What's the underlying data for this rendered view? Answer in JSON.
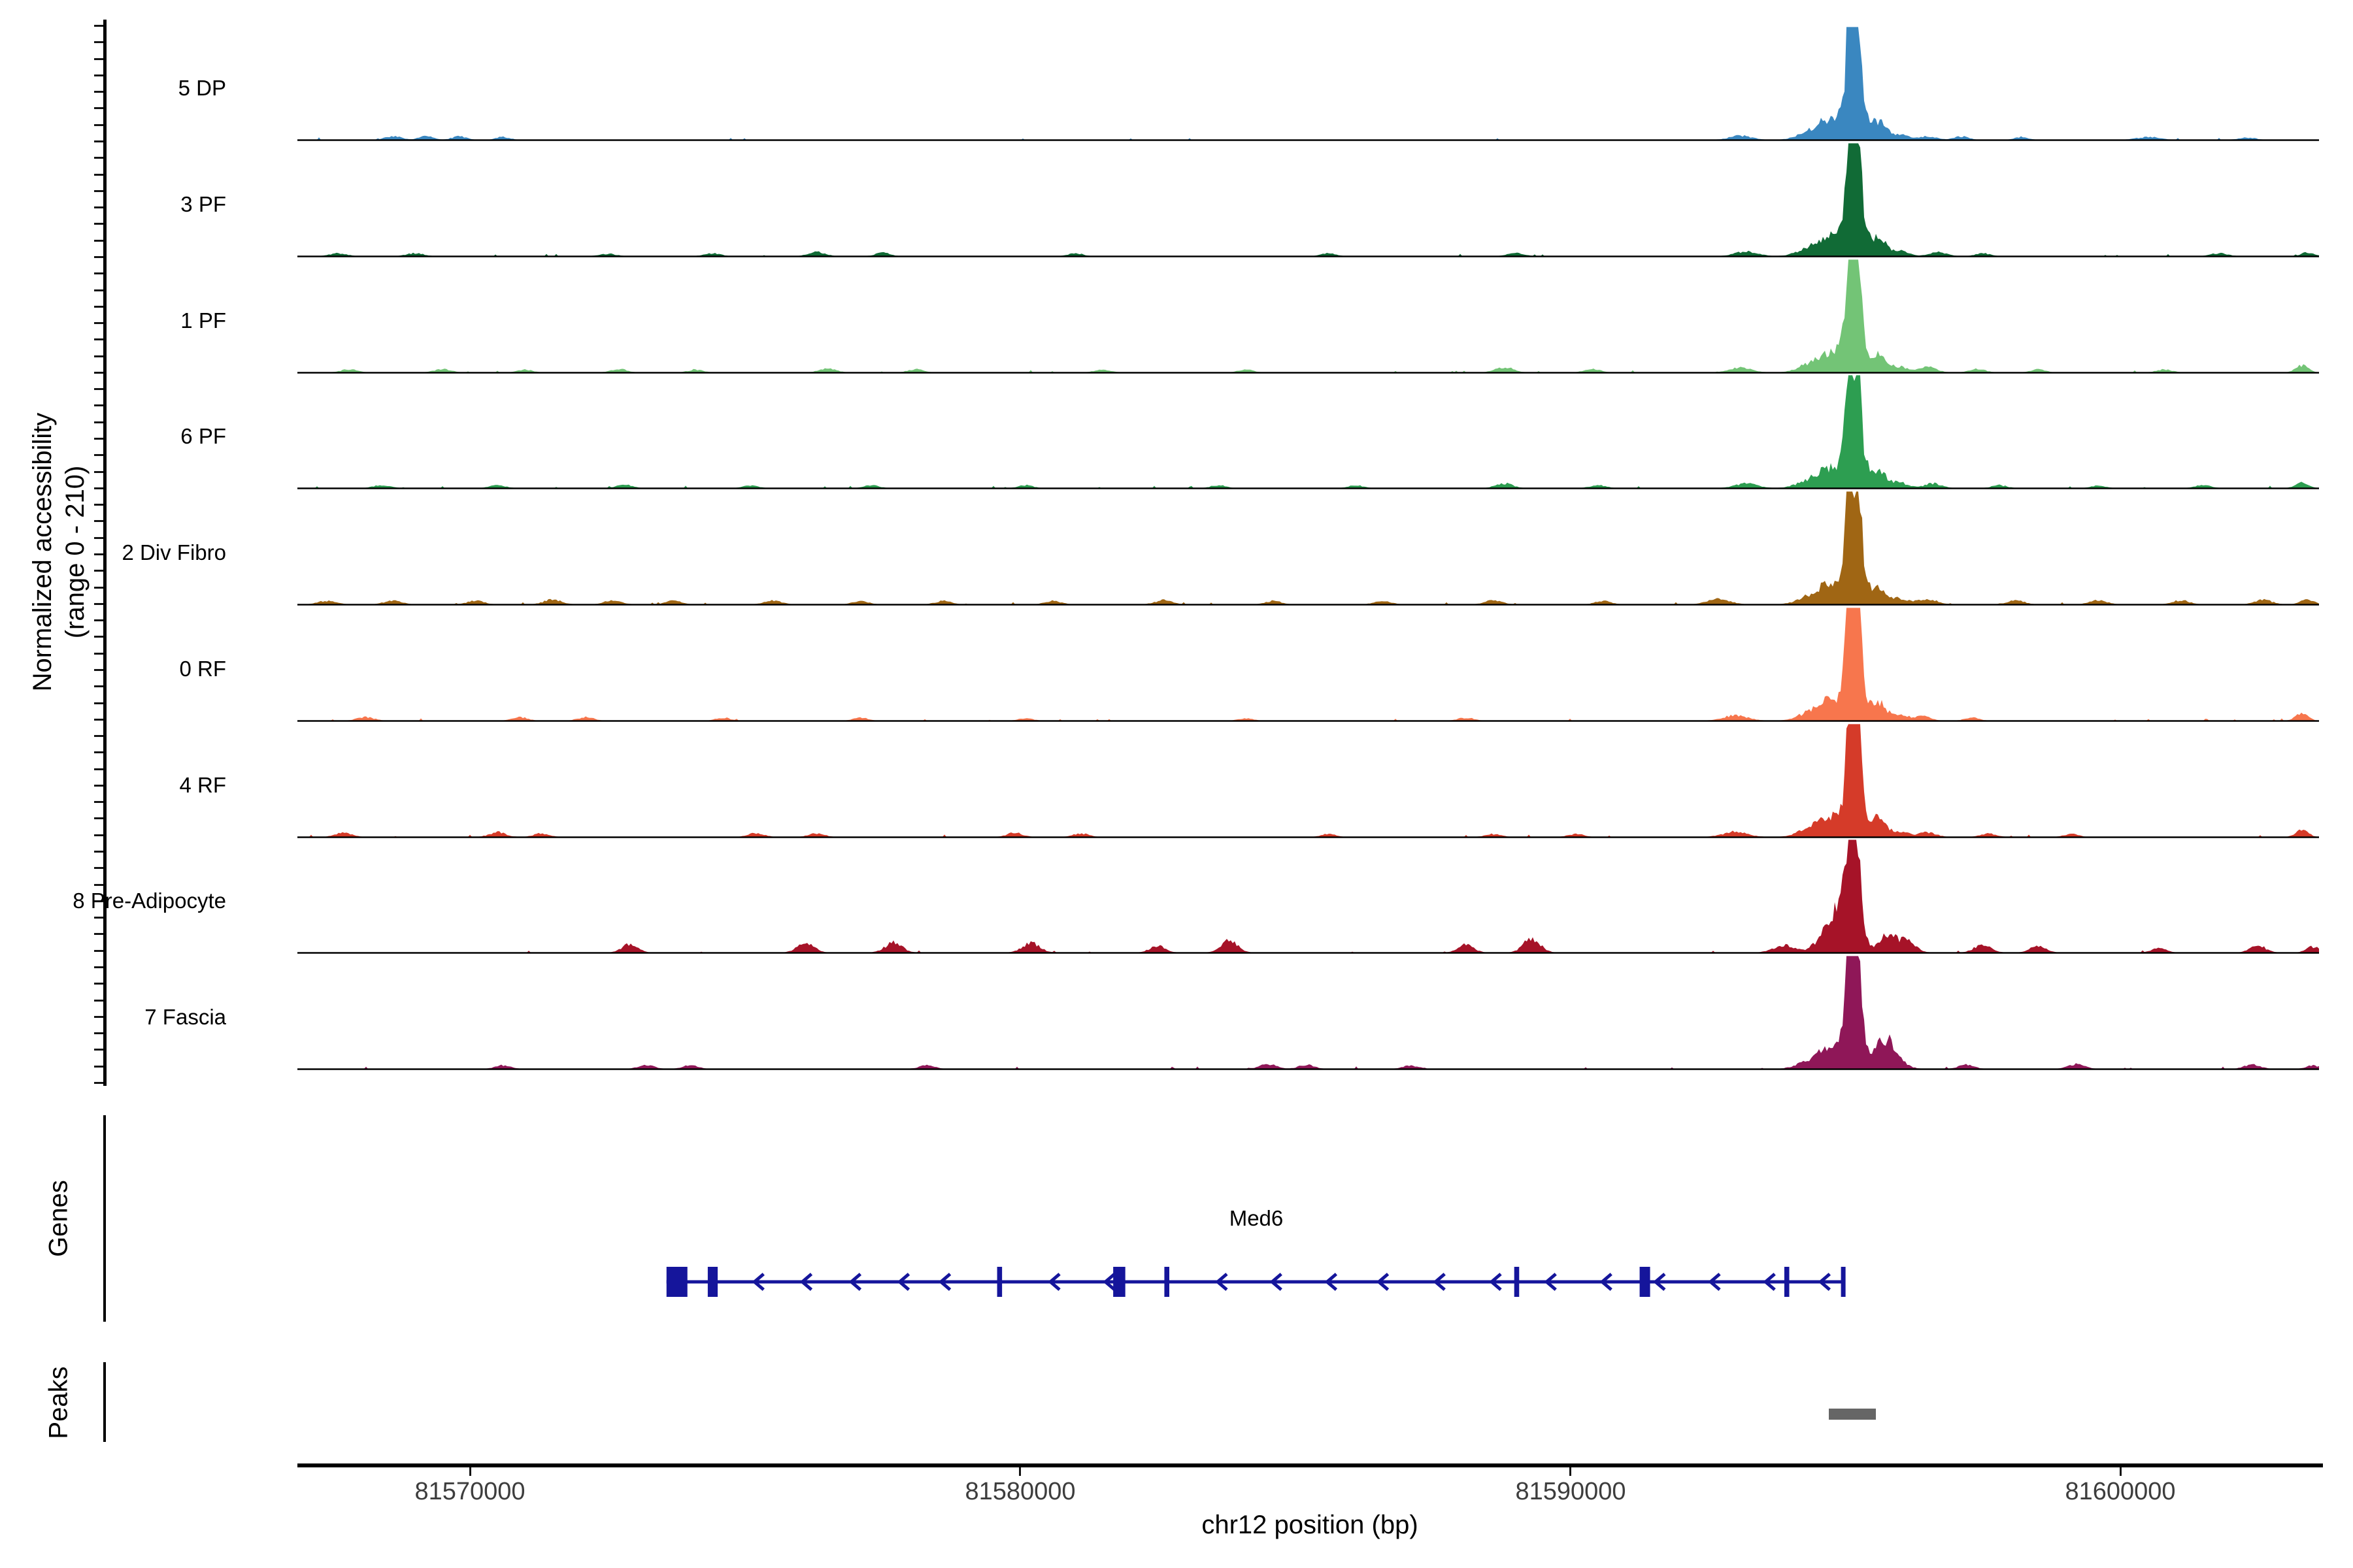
{
  "figure": {
    "background": "#ffffff",
    "y_axis": {
      "label_line1": "Normalized accessibility",
      "label_line2": "(range 0 - 210)",
      "range_min": 0,
      "range_max": 210
    },
    "x_axis": {
      "title": "chr12 position (bp)",
      "chrom": "chr12",
      "ticks": [
        81570000,
        81580000,
        81590000,
        81600000
      ]
    },
    "genes_section_label": "Genes",
    "peaks_section_label": "Peaks"
  },
  "chart_data": {
    "type": "area",
    "title": "",
    "xlabel": "chr12 position (bp)",
    "ylabel": "Normalized accessibility (range 0 - 210)",
    "x_range_bp": [
      81566860,
      81603610
    ],
    "y_range": [
      0,
      210
    ],
    "main_peak_bp": 81595150,
    "tracks": [
      {
        "label": "5 DP",
        "color": "#3a87c0",
        "bumps": [
          [
            81568600,
            6,
            150
          ],
          [
            81569200,
            7,
            120
          ],
          [
            81569800,
            6,
            130
          ],
          [
            81570600,
            5,
            120
          ],
          [
            81593100,
            7,
            200
          ],
          [
            81596500,
            6,
            150
          ],
          [
            81597100,
            6,
            130
          ],
          [
            81598200,
            5,
            120
          ],
          [
            81600500,
            5,
            200
          ],
          [
            81602300,
            4,
            150
          ],
          [
            81595080,
            190,
            50
          ],
          [
            81595230,
            168,
            45
          ],
          [
            81595150,
            135,
            150
          ],
          [
            81594700,
            30,
            180
          ],
          [
            81594350,
            13,
            220
          ],
          [
            81595600,
            30,
            120
          ],
          [
            81595950,
            10,
            180
          ]
        ]
      },
      {
        "label": "3 PF",
        "color": "#116b36",
        "bumps": [
          [
            81567600,
            5,
            150
          ],
          [
            81569000,
            5,
            150
          ],
          [
            81572500,
            4,
            150
          ],
          [
            81574400,
            5,
            140
          ],
          [
            81576300,
            7,
            150
          ],
          [
            81577500,
            6,
            130
          ],
          [
            81581000,
            5,
            130
          ],
          [
            81585600,
            5,
            130
          ],
          [
            81589000,
            5,
            150
          ],
          [
            81593200,
            8,
            200
          ],
          [
            81596700,
            7,
            150
          ],
          [
            81597500,
            5,
            130
          ],
          [
            81601800,
            5,
            150
          ],
          [
            81603400,
            6,
            120
          ],
          [
            81595080,
            190,
            50
          ],
          [
            81595230,
            168,
            45
          ],
          [
            81595150,
            135,
            150
          ],
          [
            81594700,
            30,
            180
          ],
          [
            81594350,
            13,
            220
          ],
          [
            81595600,
            30,
            120
          ],
          [
            81595950,
            10,
            180
          ]
        ]
      },
      {
        "label": "1 PF",
        "color": "#73c476",
        "bumps": [
          [
            81567800,
            5,
            150
          ],
          [
            81569500,
            6,
            150
          ],
          [
            81571000,
            5,
            130
          ],
          [
            81572700,
            6,
            140
          ],
          [
            81574100,
            5,
            130
          ],
          [
            81576500,
            7,
            150
          ],
          [
            81578100,
            6,
            130
          ],
          [
            81581500,
            5,
            140
          ],
          [
            81584100,
            5,
            130
          ],
          [
            81588800,
            9,
            160
          ],
          [
            81590400,
            6,
            140
          ],
          [
            81593100,
            8,
            200
          ],
          [
            81596500,
            9,
            160
          ],
          [
            81597400,
            6,
            140
          ],
          [
            81598500,
            5,
            130
          ],
          [
            81600800,
            5,
            140
          ],
          [
            81603300,
            12,
            110
          ],
          [
            81595080,
            190,
            50
          ],
          [
            81595230,
            168,
            45
          ],
          [
            81595150,
            135,
            150
          ],
          [
            81594700,
            30,
            180
          ],
          [
            81594350,
            13,
            220
          ],
          [
            81595600,
            30,
            120
          ],
          [
            81595950,
            10,
            180
          ]
        ]
      },
      {
        "label": "6 PF",
        "color": "#2d9e51",
        "bumps": [
          [
            81568400,
            5,
            150
          ],
          [
            81570500,
            5,
            140
          ],
          [
            81572800,
            6,
            140
          ],
          [
            81575100,
            5,
            130
          ],
          [
            81577300,
            5,
            130
          ],
          [
            81580100,
            5,
            130
          ],
          [
            81583600,
            5,
            130
          ],
          [
            81586100,
            5,
            130
          ],
          [
            81588800,
            8,
            150
          ],
          [
            81590500,
            5,
            140
          ],
          [
            81593200,
            8,
            200
          ],
          [
            81596600,
            8,
            150
          ],
          [
            81597800,
            5,
            130
          ],
          [
            81599600,
            4,
            130
          ],
          [
            81601500,
            5,
            140
          ],
          [
            81603300,
            11,
            110
          ],
          [
            81595080,
            190,
            50
          ],
          [
            81595230,
            168,
            45
          ],
          [
            81595150,
            135,
            150
          ],
          [
            81594700,
            30,
            180
          ],
          [
            81594350,
            13,
            220
          ],
          [
            81595600,
            30,
            120
          ],
          [
            81595950,
            10,
            180
          ]
        ]
      },
      {
        "label": "2 Div Fibro",
        "color": "#a06614",
        "bumps": [
          [
            81567400,
            6,
            160
          ],
          [
            81568600,
            7,
            150
          ],
          [
            81570100,
            6,
            150
          ],
          [
            81571500,
            8,
            160
          ],
          [
            81572600,
            7,
            150
          ],
          [
            81573700,
            6,
            140
          ],
          [
            81575500,
            7,
            150
          ],
          [
            81577100,
            6,
            140
          ],
          [
            81578600,
            6,
            140
          ],
          [
            81580600,
            6,
            140
          ],
          [
            81582600,
            7,
            150
          ],
          [
            81584600,
            6,
            140
          ],
          [
            81586600,
            6,
            140
          ],
          [
            81588600,
            7,
            150
          ],
          [
            81590600,
            6,
            140
          ],
          [
            81592700,
            9,
            200
          ],
          [
            81596500,
            9,
            170
          ],
          [
            81598100,
            7,
            150
          ],
          [
            81599600,
            7,
            150
          ],
          [
            81601100,
            7,
            150
          ],
          [
            81602600,
            8,
            150
          ],
          [
            81603400,
            8,
            120
          ],
          [
            81595080,
            190,
            50
          ],
          [
            81595230,
            168,
            45
          ],
          [
            81595150,
            135,
            150
          ],
          [
            81594700,
            30,
            180
          ],
          [
            81594350,
            13,
            220
          ],
          [
            81595600,
            30,
            120
          ],
          [
            81595950,
            10,
            180
          ]
        ]
      },
      {
        "label": "0 RF",
        "color": "#f7764d",
        "bumps": [
          [
            81568100,
            6,
            150
          ],
          [
            81570900,
            6,
            140
          ],
          [
            81572100,
            6,
            140
          ],
          [
            81574600,
            5,
            130
          ],
          [
            81577100,
            5,
            130
          ],
          [
            81580100,
            4,
            130
          ],
          [
            81584100,
            4,
            130
          ],
          [
            81588100,
            5,
            140
          ],
          [
            81593000,
            9,
            220
          ],
          [
            81596400,
            7,
            150
          ],
          [
            81597300,
            5,
            130
          ],
          [
            81603300,
            13,
            110
          ],
          [
            81595080,
            190,
            50
          ],
          [
            81595230,
            168,
            45
          ],
          [
            81595150,
            135,
            150
          ],
          [
            81594700,
            30,
            180
          ],
          [
            81594350,
            13,
            220
          ],
          [
            81595600,
            30,
            120
          ],
          [
            81595950,
            10,
            180
          ]
        ]
      },
      {
        "label": "4 RF",
        "color": "#d53b29",
        "bumps": [
          [
            81567700,
            7,
            150
          ],
          [
            81570500,
            8,
            150
          ],
          [
            81571300,
            6,
            140
          ],
          [
            81575200,
            7,
            140
          ],
          [
            81576300,
            6,
            140
          ],
          [
            81579900,
            7,
            140
          ],
          [
            81581100,
            6,
            140
          ],
          [
            81585600,
            5,
            130
          ],
          [
            81588600,
            5,
            140
          ],
          [
            81590100,
            5,
            140
          ],
          [
            81593000,
            9,
            220
          ],
          [
            81596500,
            8,
            150
          ],
          [
            81597600,
            6,
            140
          ],
          [
            81599100,
            5,
            130
          ],
          [
            81603300,
            12,
            110
          ],
          [
            81595080,
            190,
            50
          ],
          [
            81595230,
            168,
            45
          ],
          [
            81595150,
            135,
            150
          ],
          [
            81594700,
            30,
            180
          ],
          [
            81594350,
            13,
            220
          ],
          [
            81595600,
            30,
            120
          ],
          [
            81595950,
            10,
            180
          ]
        ]
      },
      {
        "label": "8 Pre-Adipocyte",
        "color": "#a61328",
        "bumps": [
          [
            81572900,
            14,
            140
          ],
          [
            81576100,
            16,
            150
          ],
          [
            81577700,
            18,
            150
          ],
          [
            81580200,
            16,
            160
          ],
          [
            81582500,
            12,
            140
          ],
          [
            81583800,
            20,
            150
          ],
          [
            81588100,
            14,
            140
          ],
          [
            81589300,
            24,
            150
          ],
          [
            81596100,
            22,
            160
          ],
          [
            81597500,
            14,
            150
          ],
          [
            81598500,
            12,
            140
          ],
          [
            81600700,
            8,
            130
          ],
          [
            81602500,
            12,
            140
          ],
          [
            81603500,
            10,
            120
          ],
          [
            81595150,
            205,
            80
          ],
          [
            81595050,
            130,
            180
          ],
          [
            81594650,
            32,
            180
          ],
          [
            81595750,
            28,
            140
          ],
          [
            81593900,
            12,
            200
          ]
        ]
      },
      {
        "label": "7 Fascia",
        "color": "#8f1758",
        "bumps": [
          [
            81570600,
            6,
            140
          ],
          [
            81573200,
            7,
            140
          ],
          [
            81574000,
            6,
            140
          ],
          [
            81578300,
            6,
            140
          ],
          [
            81584500,
            8,
            150
          ],
          [
            81585200,
            7,
            140
          ],
          [
            81587100,
            6,
            140
          ],
          [
            81595800,
            36,
            130
          ],
          [
            81597200,
            7,
            140
          ],
          [
            81599200,
            8,
            150
          ],
          [
            81602400,
            8,
            140
          ],
          [
            81603500,
            6,
            120
          ],
          [
            81595080,
            190,
            50
          ],
          [
            81595230,
            168,
            45
          ],
          [
            81595150,
            135,
            150
          ],
          [
            81594700,
            30,
            180
          ],
          [
            81594350,
            13,
            220
          ],
          [
            81595600,
            30,
            120
          ],
          [
            81595950,
            10,
            180
          ]
        ]
      }
    ],
    "gene_track": {
      "gene_name": "Med6",
      "strand": "-",
      "color": "#15159b",
      "start_bp": 81573570,
      "end_bp": 81595000,
      "exons": [
        {
          "start": 81573570,
          "end": 81573950
        },
        {
          "start": 81574320,
          "end": 81574500
        },
        {
          "start": 81579580,
          "end": 81579670
        },
        {
          "start": 81581690,
          "end": 81581910
        },
        {
          "start": 81582620,
          "end": 81582710
        },
        {
          "start": 81588980,
          "end": 81589070
        },
        {
          "start": 81591260,
          "end": 81591450
        },
        {
          "start": 81593890,
          "end": 81593980
        },
        {
          "start": 81594920,
          "end": 81595000
        }
      ],
      "arrow_positions_bp": [
        81575240,
        81576110,
        81577000,
        81577880,
        81578630,
        81580620,
        81581620,
        81583660,
        81584650,
        81585650,
        81586590,
        81587620,
        81588640,
        81589640,
        81590650,
        81591620,
        81592620,
        81593620,
        81594620
      ]
    },
    "peak_track": {
      "color": "#666666",
      "regions": [
        {
          "start_bp": 81594700,
          "end_bp": 81595560
        }
      ]
    }
  }
}
